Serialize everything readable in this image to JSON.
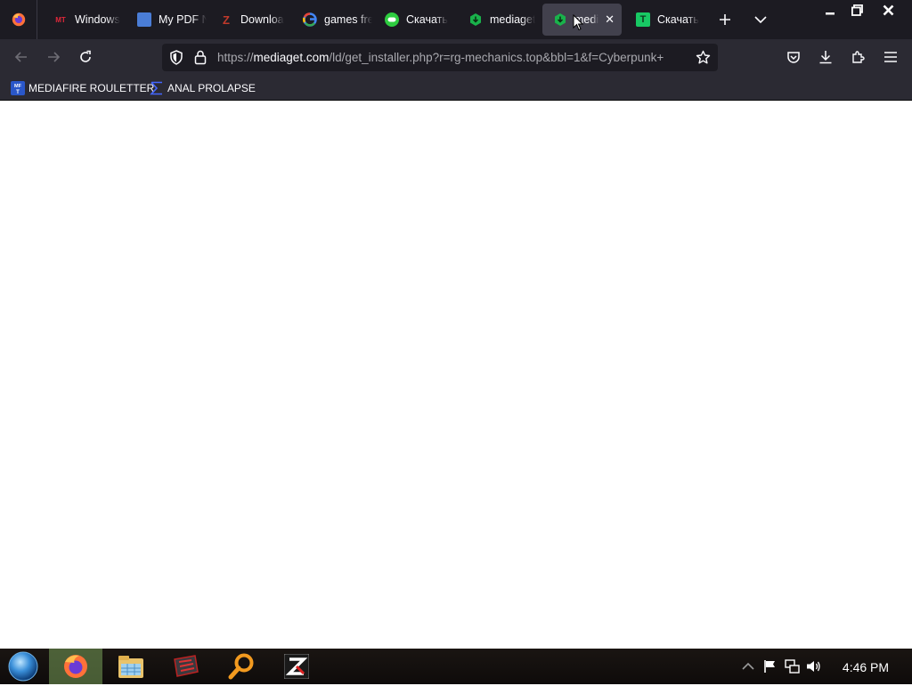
{
  "tabs": [
    {
      "label": "Windows",
      "favicon": "mt-icon",
      "favicon_text": "MT",
      "color": "#e0283a"
    },
    {
      "label": "My PDF N",
      "favicon": "pdf-icon",
      "color": "#4a7dd6"
    },
    {
      "label": "Downloa",
      "favicon": "z-icon",
      "color": "#c0392b"
    },
    {
      "label": "games fre",
      "favicon": "google-icon",
      "color": "#4285f4"
    },
    {
      "label": "Скачать",
      "favicon": "gamepad-icon",
      "color": "#2ecc40"
    },
    {
      "label": "mediaget",
      "favicon": "mediaget-icon",
      "color": "#19b24b"
    },
    {
      "label": "medi",
      "favicon": "mediaget-icon",
      "color": "#19b24b",
      "active": true
    },
    {
      "label": "Скачать",
      "favicon": "t-icon",
      "favicon_text": "T",
      "color": "#18c964"
    }
  ],
  "url": {
    "scheme": "https://",
    "host": "mediaget.com",
    "path": "/ld/get_installer.php?r=rg-mechanics.top&bbl=1&f=Cyberpunk+"
  },
  "bookmarks": [
    {
      "label": "MEDIAFIRE ROULETTER",
      "icon": "mft-icon",
      "icon_text": "MFT"
    },
    {
      "label": "ANAL PROLAPSE",
      "icon": "sigma-icon"
    }
  ],
  "taskbar": {
    "items": [
      "start-orb",
      "firefox-icon",
      "file-explorer-icon",
      "app-icon",
      "search-icon",
      "z-app-icon"
    ],
    "clock": "4:46 PM"
  },
  "colors": {
    "tabstrip": "#1c1b22",
    "navbar": "#2b2a33",
    "urlbar": "#1c1b22",
    "active_tab": "#42414d"
  }
}
